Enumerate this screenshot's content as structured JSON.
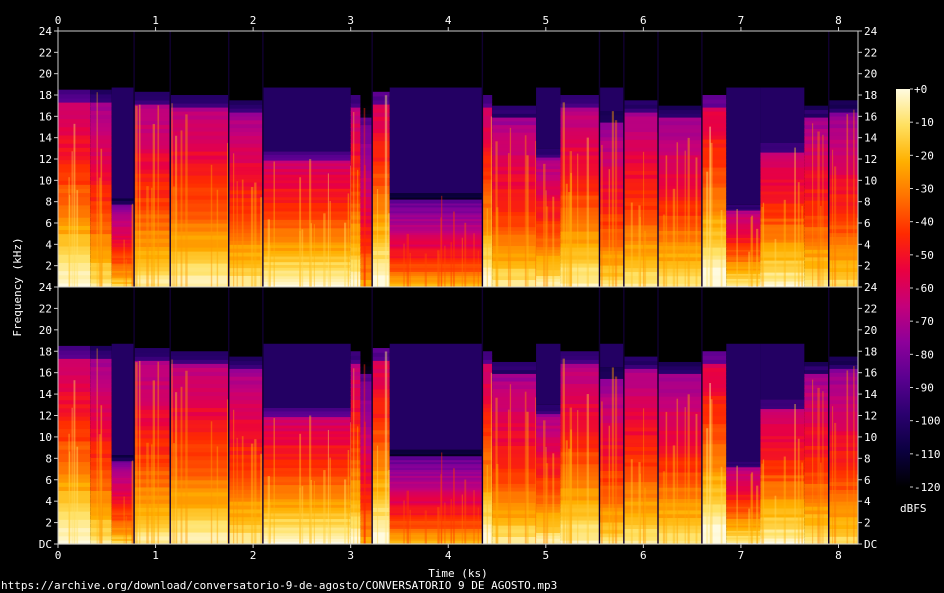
{
  "chart_data": {
    "type": "heatmap",
    "subtype": "spectrogram",
    "xlabel": "Time (ks)",
    "ylabel": "Frequency (kHz)",
    "x_range": [
      0,
      8.2
    ],
    "x_ticks": [
      0,
      1,
      2,
      3,
      4,
      5,
      6,
      7,
      8
    ],
    "y_range": [
      0,
      24
    ],
    "y_ticks": [
      "DC",
      "2",
      "4",
      "6",
      "8",
      "10",
      "12",
      "14",
      "16",
      "18",
      "20",
      "22",
      "24"
    ],
    "channels": 2,
    "colorbar": {
      "label": "dBFS",
      "range": [
        -120,
        0
      ],
      "ticks": [
        "+0",
        "-10",
        "-20",
        "-30",
        "-40",
        "-50",
        "-60",
        "-70",
        "-80",
        "-90",
        "-100",
        "-110",
        "-120"
      ],
      "colors": [
        "#000000",
        "#0b0040",
        "#2a006e",
        "#5a0090",
        "#8d009a",
        "#c4007a",
        "#ea0040",
        "#ff2a00",
        "#ff7000",
        "#ffb000",
        "#ffe060",
        "#fffbe0"
      ]
    },
    "segments": [
      {
        "t0": 0.0,
        "t1": 0.33,
        "cutoff_khz": 18.5,
        "intensity": 0.7
      },
      {
        "t0": 0.33,
        "t1": 0.55,
        "cutoff_khz": 18.5,
        "intensity": 0.62
      },
      {
        "t0": 0.55,
        "t1": 0.78,
        "cutoff_khz": 8.3,
        "intensity": 0.58
      },
      {
        "t0": 0.78,
        "t1": 1.15,
        "cutoff_khz": 18.3,
        "intensity": 0.64
      },
      {
        "t0": 1.15,
        "t1": 1.75,
        "cutoff_khz": 18.0,
        "intensity": 0.66
      },
      {
        "t0": 1.75,
        "t1": 2.1,
        "cutoff_khz": 17.5,
        "intensity": 0.63
      },
      {
        "t0": 2.1,
        "t1": 3.0,
        "cutoff_khz": 12.7,
        "intensity": 0.7
      },
      {
        "t0": 3.0,
        "t1": 3.1,
        "cutoff_khz": 18.0,
        "intensity": 0.68
      },
      {
        "t0": 3.1,
        "t1": 3.22,
        "cutoff_khz": 17.0,
        "intensity": 0.5
      },
      {
        "t0": 3.22,
        "t1": 3.4,
        "cutoff_khz": 18.3,
        "intensity": 0.72
      },
      {
        "t0": 3.4,
        "t1": 4.35,
        "cutoff_khz": 8.8,
        "intensity": 0.52
      },
      {
        "t0": 4.35,
        "t1": 4.45,
        "cutoff_khz": 18.0,
        "intensity": 0.7
      },
      {
        "t0": 4.45,
        "t1": 4.9,
        "cutoff_khz": 17.0,
        "intensity": 0.62
      },
      {
        "t0": 4.9,
        "t1": 5.15,
        "cutoff_khz": 13.0,
        "intensity": 0.64
      },
      {
        "t0": 5.15,
        "t1": 5.55,
        "cutoff_khz": 18.0,
        "intensity": 0.66
      },
      {
        "t0": 5.55,
        "t1": 5.8,
        "cutoff_khz": 16.5,
        "intensity": 0.6
      },
      {
        "t0": 5.8,
        "t1": 6.15,
        "cutoff_khz": 17.5,
        "intensity": 0.64
      },
      {
        "t0": 6.15,
        "t1": 6.6,
        "cutoff_khz": 17.0,
        "intensity": 0.62
      },
      {
        "t0": 6.6,
        "t1": 6.85,
        "cutoff_khz": 18.0,
        "intensity": 0.74
      },
      {
        "t0": 6.85,
        "t1": 7.2,
        "cutoff_khz": 7.7,
        "intensity": 0.66
      },
      {
        "t0": 7.2,
        "t1": 7.65,
        "cutoff_khz": 13.5,
        "intensity": 0.68
      },
      {
        "t0": 7.65,
        "t1": 7.9,
        "cutoff_khz": 17.0,
        "intensity": 0.62
      },
      {
        "t0": 7.9,
        "t1": 8.2,
        "cutoff_khz": 17.5,
        "intensity": 0.6
      }
    ],
    "silence_dividers_ks": [
      0.78,
      1.15,
      1.75,
      2.1,
      3.22,
      4.35,
      5.55,
      5.8,
      6.15,
      6.6,
      7.9
    ]
  },
  "source_url": "https://archive.org/download/conversatorio-9-de-agosto/CONVERSATORIO 9 DE AGOSTO.mp3"
}
